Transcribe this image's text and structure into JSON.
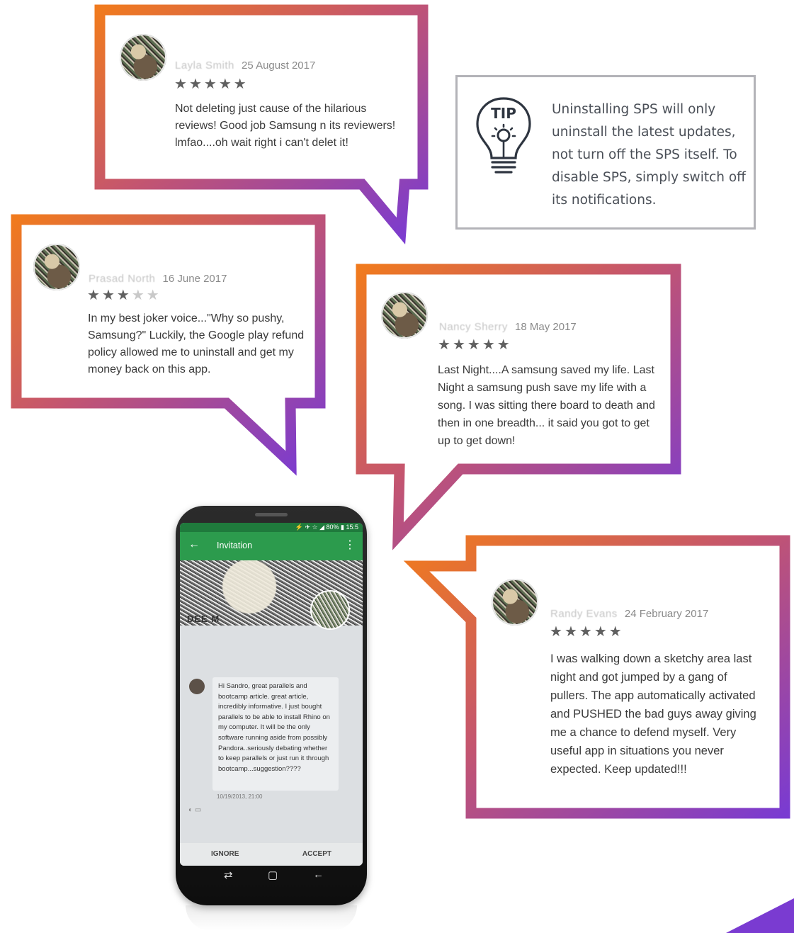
{
  "reviews": [
    {
      "id": "r1",
      "name": "Layla Smith",
      "date": "25 August 2017",
      "stars_filled": 5,
      "stars_total": 5,
      "text": "Not deleting just cause of the hilarious reviews! Good job Samsung n its reviewers! lmfao....oh wait right i can't delet it!"
    },
    {
      "id": "r2",
      "name": "Prasad North",
      "date": "16 June 2017",
      "stars_filled": 3,
      "stars_total": 5,
      "text": "In my best joker voice...\"Why so pushy, Samsung?\" Luckily, the Google play refund policy allowed me to uninstall and get my money back on this app."
    },
    {
      "id": "r3",
      "name": "Nancy Sherry",
      "date": "18 May 2017",
      "stars_filled": 5,
      "stars_total": 5,
      "text": "Last Night....A samsung saved my life. Last Night a samsung push save my life with a song. I was sitting there board to death and then in one breadth... it said you got to get up to get down!"
    },
    {
      "id": "r4",
      "name": "Randy Evans",
      "date": "24 February 2017",
      "stars_filled": 5,
      "stars_total": 5,
      "text": "I was walking down a sketchy area last night and got jumped by a gang of pullers. The app automatically activated and PUSHED the bad guys away giving me a chance to defend myself. Very useful app in situations you never expected. Keep updated!!!"
    }
  ],
  "tip": {
    "icon_label": "TIP",
    "text": "Uninstalling SPS will only uninstall the latest updates, not turn off the SPS itself. To disable SPS, simply switch off its notifications."
  },
  "phone": {
    "status": "⚡ ✈ ☆ ◢ 80% ▮ 15:5",
    "back_icon": "←",
    "title": "Invitation",
    "more_icon": "⋮",
    "contact_name": "DEE M",
    "message": "Hi Sandro, great parallels and bootcamp article. great article, incredibly informative. I just bought parallels to be able to install Rhino on my computer. It will be the only software running aside from possibly Pandora..seriously debating whether to keep parallels or just run it through bootcamp...suggestion????",
    "message_date": "10/19/2013, 21:00",
    "ignore_label": "IGNORE",
    "accept_label": "ACCEPT",
    "nav_recent": "⇄",
    "nav_home": "▢",
    "nav_back": "←"
  },
  "colors": {
    "gradient_start": "#f07a1e",
    "gradient_end": "#7a3bd1",
    "app_green": "#2c9b4d",
    "tip_border": "#b3b3b8"
  },
  "icons": [
    "tip-lightbulb-icon",
    "star-icon",
    "back-arrow-icon",
    "more-vert-icon",
    "home-icon",
    "recent-apps-icon"
  ]
}
